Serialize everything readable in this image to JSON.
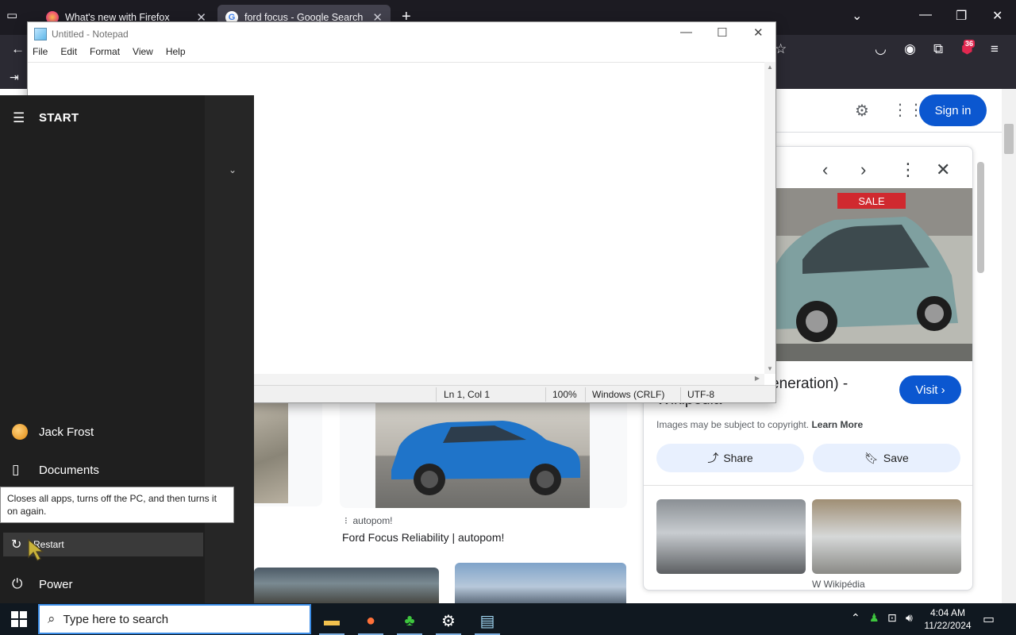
{
  "browser": {
    "tabs": [
      {
        "label": "What's new with Firefox"
      },
      {
        "label": "ford focus - Google Search"
      }
    ],
    "badge_count": "36"
  },
  "google": {
    "sign_in": "Sign in",
    "results": [
      {
        "source": "autopom!",
        "title": "Ford Focus Reliability | autopom!"
      }
    ],
    "panel": {
      "title": "eneration) -",
      "subtitle": "Wikipedia",
      "visit": "Visit",
      "copyright": "Images may be subject to copyright.",
      "learn_more": "Learn More",
      "share": "Share",
      "save": "Save",
      "related_source": "Wikipédia",
      "sale_sign": "SALE"
    }
  },
  "notepad": {
    "title": "Untitled - Notepad",
    "menu": [
      "File",
      "Edit",
      "Format",
      "View",
      "Help"
    ],
    "status": {
      "position": "Ln 1, Col 1",
      "zoom": "100%",
      "line_ending": "Windows (CRLF)",
      "encoding": "UTF-8"
    }
  },
  "start_menu": {
    "title": "START",
    "user": "Jack Frost",
    "documents": "Documents",
    "restart": "Restart",
    "power": "Power",
    "tooltip": "Closes all apps, turns off the PC, and then turns it on again."
  },
  "taskbar": {
    "search_placeholder": "Type here to search",
    "time": "4:04 AM",
    "date": "11/22/2024"
  },
  "colors": {
    "google_blue": "#0b57d0",
    "start_bg": "#1f1f1f",
    "taskbar_bg": "#101820"
  }
}
